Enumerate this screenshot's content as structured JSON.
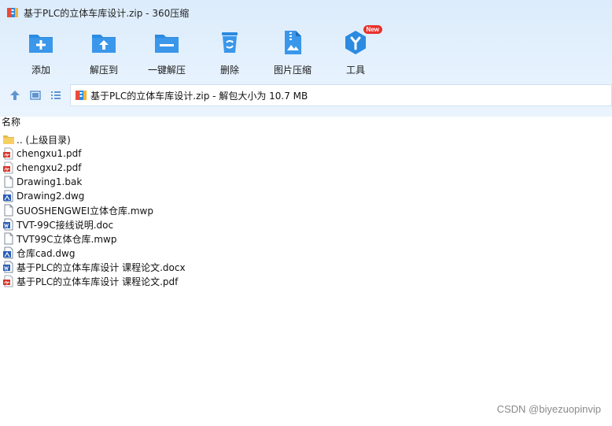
{
  "window": {
    "title": "基于PLC的立体车库设计.zip - 360压缩"
  },
  "toolbar": {
    "add_label": "添加",
    "extract_label": "解压到",
    "oneclick_label": "一键解压",
    "delete_label": "删除",
    "image_label": "图片压缩",
    "tools_label": "工具",
    "tools_badge": "New"
  },
  "navbar": {
    "path_text": "基于PLC的立体车库设计.zip - 解包大小为 10.7 MB"
  },
  "list": {
    "column_name": "名称",
    "items": [
      {
        "name": ".. (上级目录)",
        "icon": "folder-icon"
      },
      {
        "name": "chengxu1.pdf",
        "icon": "pdf-file-icon"
      },
      {
        "name": "chengxu2.pdf",
        "icon": "pdf-file-icon"
      },
      {
        "name": "Drawing1.bak",
        "icon": "blank-file-icon"
      },
      {
        "name": "Drawing2.dwg",
        "icon": "dwg-file-icon"
      },
      {
        "name": "GUOSHENGWEI立体仓库.mwp",
        "icon": "blank-file-icon"
      },
      {
        "name": "TVT-99C接线说明.doc",
        "icon": "word-file-icon"
      },
      {
        "name": "TVT99C立体仓库.mwp",
        "icon": "blank-file-icon"
      },
      {
        "name": "仓库cad.dwg",
        "icon": "dwg-file-icon"
      },
      {
        "name": "基于PLC的立体车库设计 课程论文.docx",
        "icon": "word-file-icon"
      },
      {
        "name": "基于PLC的立体车库设计 课程论文.pdf",
        "icon": "pdf-file-icon"
      }
    ]
  },
  "watermark": {
    "text": "CSDN @biyezuopinvip"
  },
  "colors": {
    "toolbar_bg": "#dcecfc",
    "icon_blue": "#2b8be0",
    "badge_red": "#e8322d",
    "pdf_red": "#d9362b",
    "word_blue": "#2a5eb8",
    "folder_yellow": "#f6cf63"
  }
}
